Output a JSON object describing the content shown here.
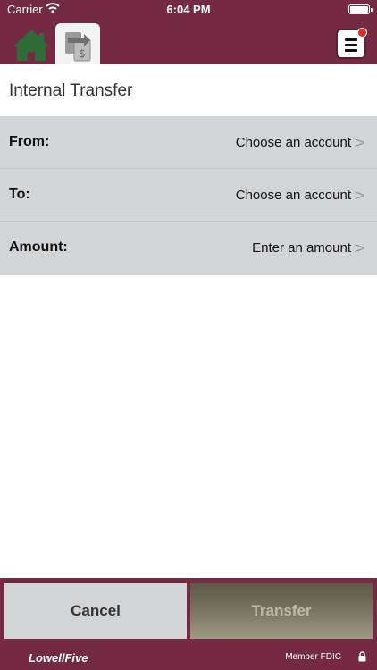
{
  "status": {
    "carrier": "Carrier",
    "time": "6:04 PM"
  },
  "nav": {
    "tabs": [
      {
        "name": "home",
        "icon": "home-icon"
      },
      {
        "name": "transfer",
        "icon": "transfer-icon",
        "active": true
      }
    ],
    "menu_icon": "hamburger-menu-icon",
    "notification_dot": true
  },
  "page": {
    "title": "Internal Transfer"
  },
  "form": {
    "rows": [
      {
        "label": "From:",
        "value": "Choose an account"
      },
      {
        "label": "To:",
        "value": "Choose an account"
      },
      {
        "label": "Amount:",
        "value": "Enter an amount"
      }
    ],
    "chevron": ">"
  },
  "actions": {
    "cancel": "Cancel",
    "transfer": "Transfer"
  },
  "footer": {
    "logo_text": "LowellFive",
    "fdic": "Member FDIC"
  },
  "colors": {
    "brand": "#742a43",
    "row_bg": "#d3d4d6",
    "home_green": "#2e6b37"
  }
}
